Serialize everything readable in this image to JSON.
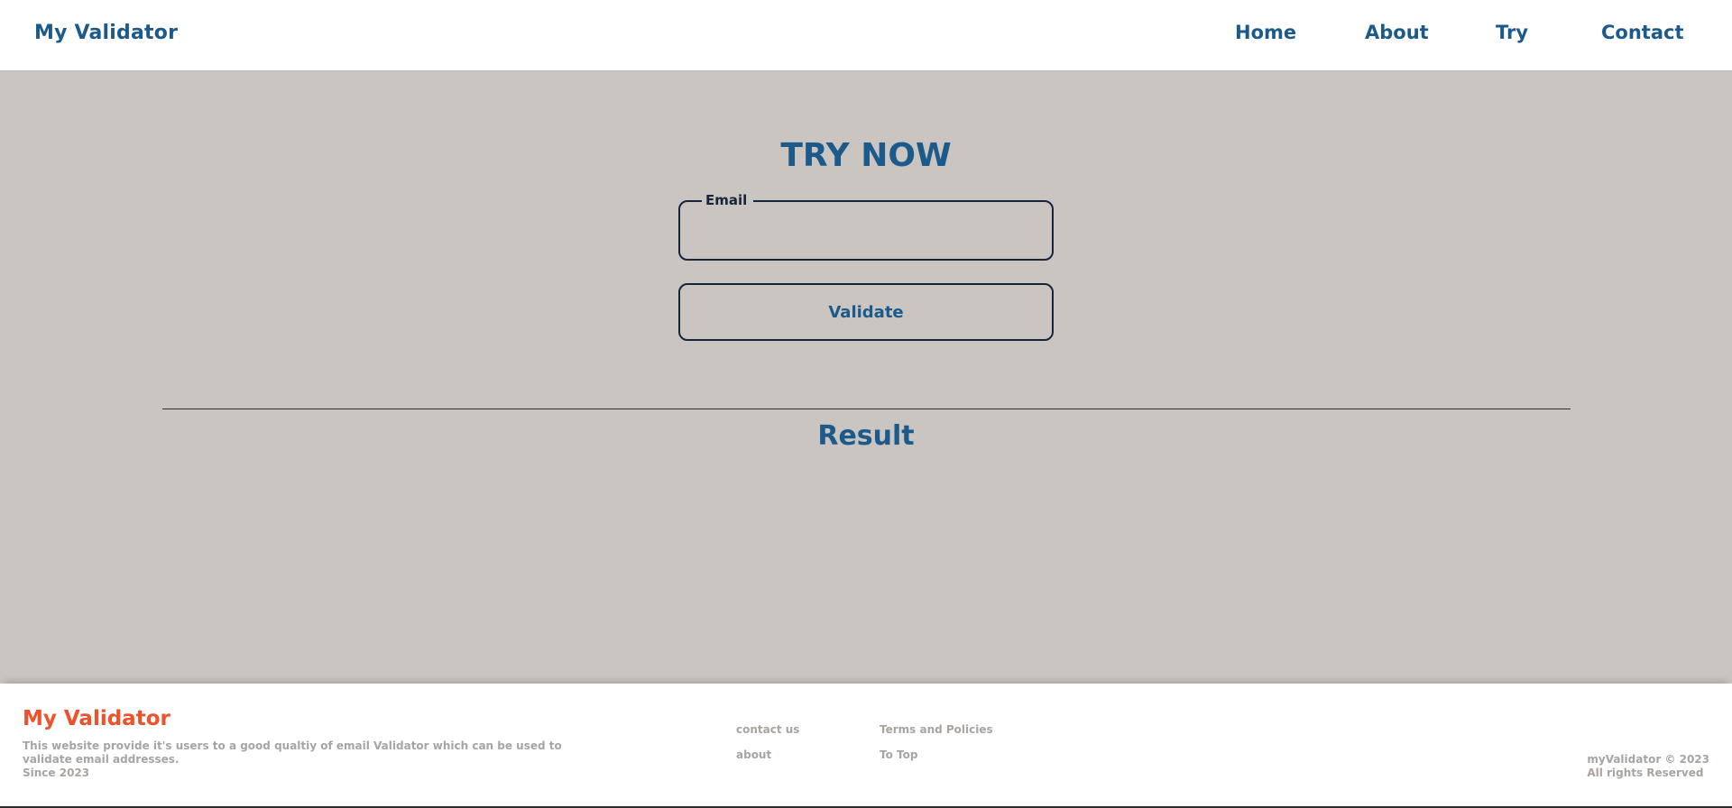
{
  "header": {
    "brand": "My Validator",
    "nav": {
      "home": "Home",
      "about": "About",
      "try": "Try",
      "contact": "Contact"
    }
  },
  "main": {
    "title": "TRY NOW",
    "email_legend": "Email",
    "email_value": "",
    "validate_label": "Validate",
    "result_title": "Result"
  },
  "footer": {
    "brand": "My Validator",
    "description_line1": "This website provide it's users to a good qualtiy of email Validator which can be used to",
    "description_line2": "validate email addresses.",
    "description_line3": "Since 2023",
    "links": {
      "contact_us": "contact us",
      "terms": "Terms and Policies",
      "about": "about",
      "to_top": "To Top"
    },
    "copyright_line1": "myValidator © 2023",
    "copyright_line2": "All rights Reserved"
  },
  "colors": {
    "brand_blue": "#1b5a8b",
    "footer_brand_orange": "#f0502a",
    "page_background": "#cac5c0",
    "muted_text": "#a9a4a0"
  }
}
